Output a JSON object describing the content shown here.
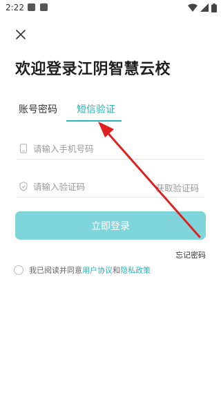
{
  "status_bar": {
    "time": "2:22"
  },
  "header": {
    "title": "欢迎登录江阴智慧云校"
  },
  "tabs": [
    {
      "label": "账号密码",
      "active": false
    },
    {
      "label": "短信验证",
      "active": true
    }
  ],
  "form": {
    "phone": {
      "placeholder": "请输入手机号码",
      "value": ""
    },
    "code": {
      "placeholder": "请输入验证码",
      "value": ""
    },
    "get_code_label": "获取验证码",
    "login_label": "立即登录",
    "forgot_label": "忘记密码"
  },
  "agreement": {
    "prefix": "我已阅读并同意",
    "user_agreement": "用户协议",
    "and": "和",
    "privacy_policy": "隐私政策"
  },
  "colors": {
    "accent": "#2ab3b8",
    "button_bg": "#7fd6da",
    "annotation_arrow": "#e02020"
  },
  "icons": [
    "close-icon",
    "phone-icon",
    "shield-icon",
    "wifi-icon",
    "signal-icon",
    "battery-icon"
  ]
}
